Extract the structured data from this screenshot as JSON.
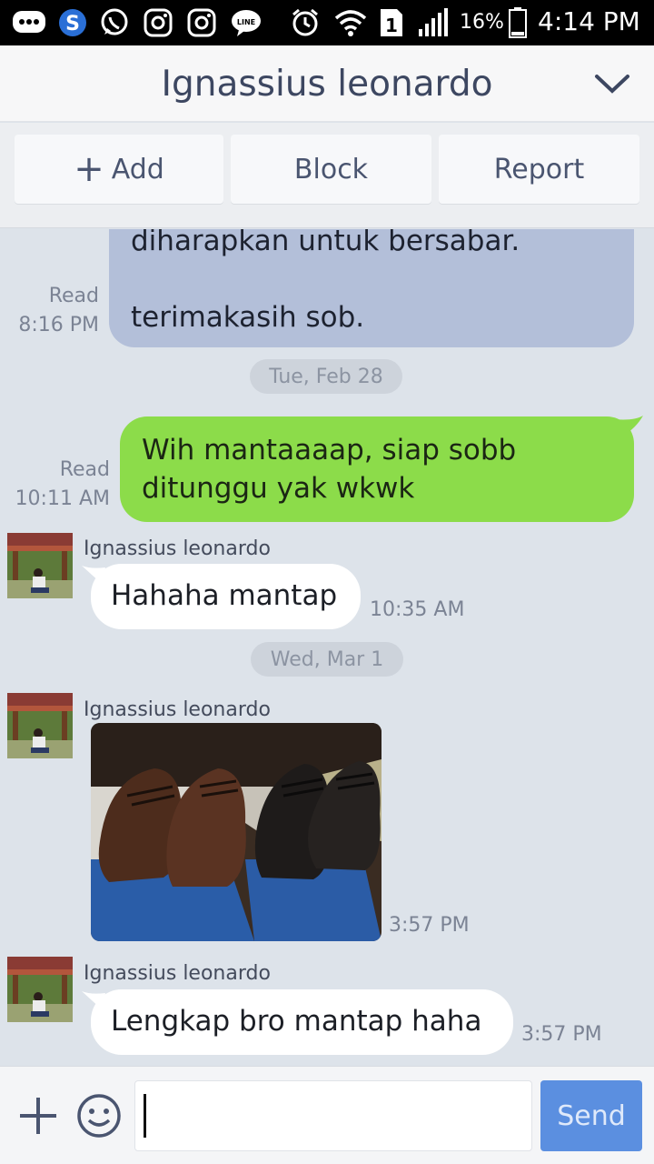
{
  "status_bar": {
    "battery_percent": "16%",
    "time": "4:14 PM",
    "sim_slot": "1",
    "icons": [
      "message-icon",
      "skype-icon",
      "whatsapp-icon",
      "instagram-icon",
      "instagram-icon",
      "line-icon",
      "alarm-icon",
      "wifi-icon",
      "sim-icon",
      "signal-icon",
      "battery-icon"
    ],
    "line_label": "LINE"
  },
  "header": {
    "title": "Ignassius leonardo",
    "chevron_icon": "chevron-down-icon"
  },
  "actions": {
    "add_label": "Add",
    "block_label": "Block",
    "report_label": "Report"
  },
  "messages": {
    "m1": {
      "line1": "diharapkan untuk bersabar.",
      "line2": "terimakasih sob.",
      "status": "Read",
      "time": "8:16 PM"
    },
    "date1": "Tue, Feb 28",
    "m2": {
      "line1": "Wih mantaaaap, siap sobb",
      "line2": "ditunggu yak wkwk",
      "status": "Read",
      "time": "10:11 AM"
    },
    "m3": {
      "sender": "Ignassius leonardo",
      "text": "Hahaha mantap",
      "time": "10:35 AM"
    },
    "date2": "Wed, Mar 1",
    "m4": {
      "sender": "Ignassius leonardo",
      "time": "3:57 PM"
    },
    "m5": {
      "sender": "Ignassius leonardo",
      "text": "Lengkap bro mantap haha",
      "time": "3:57 PM"
    }
  },
  "input": {
    "value": "",
    "send_label": "Send"
  },
  "colors": {
    "status_bg": "#000000",
    "header_bg": "#f7f7f8",
    "title": "#3d4761",
    "chat_bg": "#dde3ea",
    "bubble_blue": "#b3bfd9",
    "bubble_green": "#8cdc4a",
    "bubble_white": "#ffffff",
    "send_button": "#5b8fe0"
  }
}
